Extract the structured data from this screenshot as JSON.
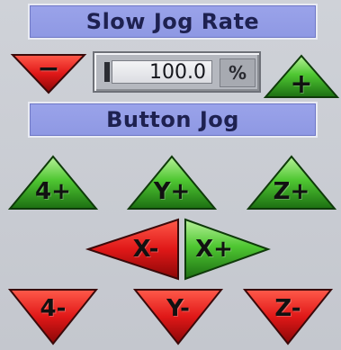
{
  "headers": {
    "rate_title": "Slow Jog Rate",
    "jog_title": "Button Jog"
  },
  "rate": {
    "value": "100.0",
    "unit": "%",
    "minus_label": "−",
    "plus_label": "+"
  },
  "jog": {
    "up_row": [
      "4+",
      "Y+",
      "Z+"
    ],
    "x_minus": "X-",
    "x_plus": "X+",
    "down_row": [
      "4-",
      "Y-",
      "Z-"
    ]
  },
  "colors": {
    "green": "#3fbf2a",
    "red": "#e01818",
    "header": "#9aa3ea"
  }
}
